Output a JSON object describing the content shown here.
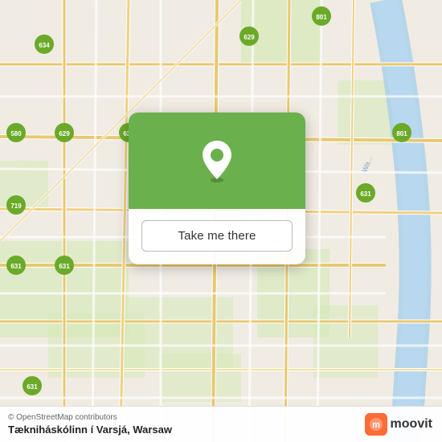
{
  "map": {
    "bg_color": "#e8e4dc",
    "alt": "Map of Warsaw"
  },
  "card": {
    "button_label": "Take me there",
    "pin_color": "#6ab04c"
  },
  "bottom": {
    "credit": "© OpenStreetMap contributors",
    "location_name": "Tækniháskólinn í Varsjá, Warsaw"
  },
  "moovit": {
    "label": "moovit"
  }
}
